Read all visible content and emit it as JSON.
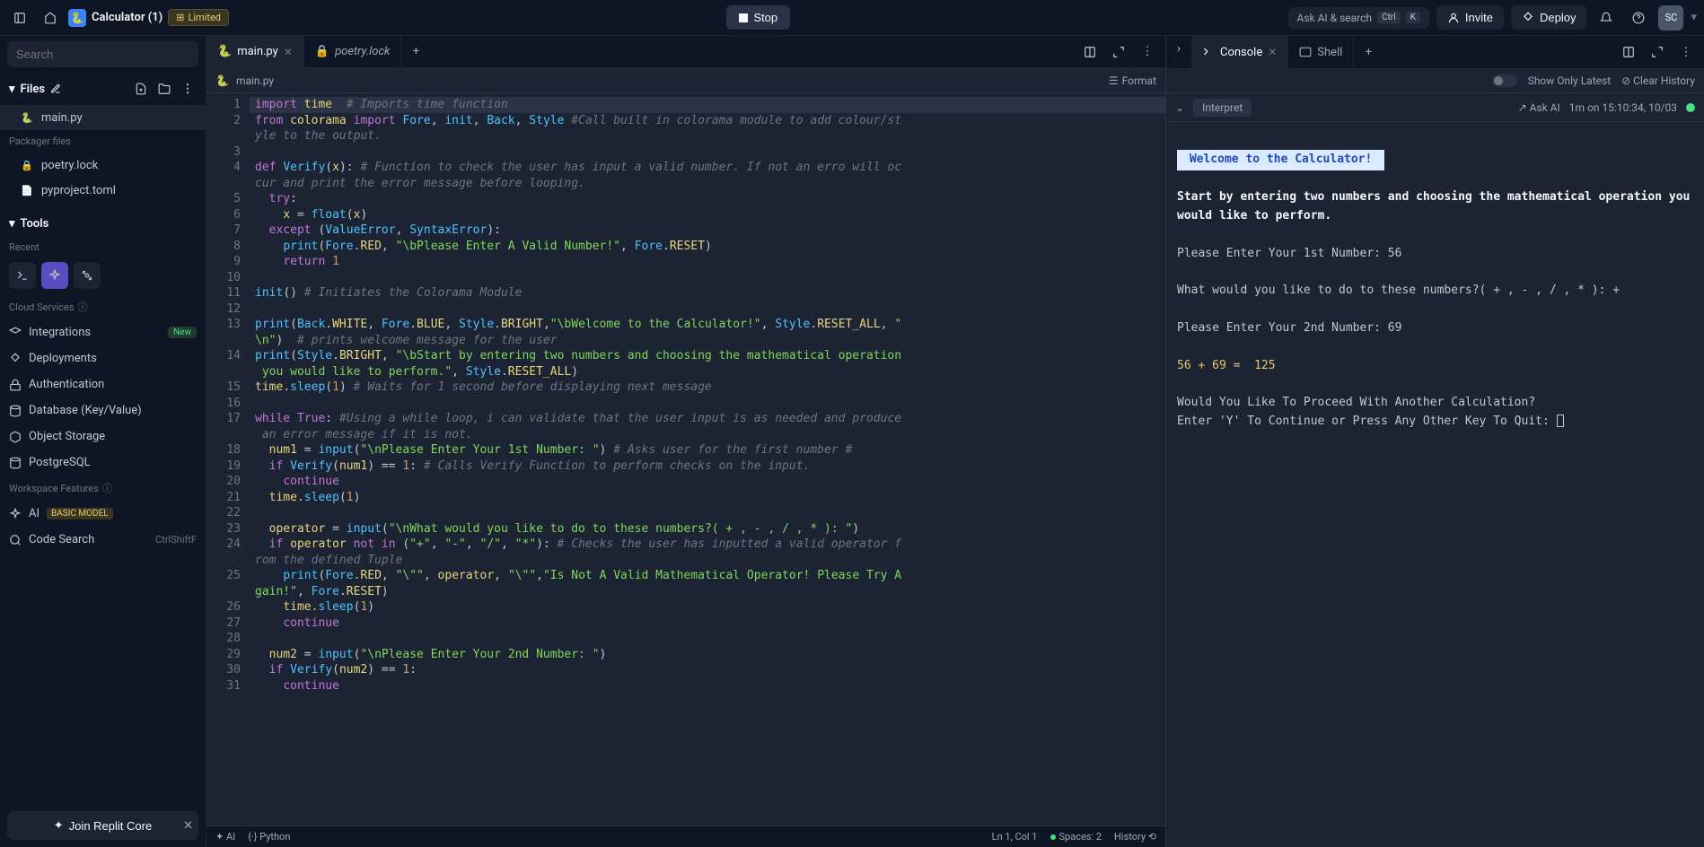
{
  "topbar": {
    "app_name": "Calculator (1)",
    "limited": "Limited",
    "stop": "Stop",
    "ask_ai": "Ask AI & search",
    "kbd_ctrl": "Ctrl",
    "kbd_k": "K",
    "invite": "Invite",
    "deploy": "Deploy",
    "avatar": "SC"
  },
  "sidebar": {
    "search_placeholder": "Search",
    "files_label": "Files",
    "files": [
      {
        "name": "main.py",
        "icon": "🐍"
      }
    ],
    "packager_label": "Packager files",
    "pkg": [
      {
        "name": "poetry.lock",
        "icon": "🔒"
      },
      {
        "name": "pyproject.toml",
        "icon": "📄"
      }
    ],
    "tools_label": "Tools",
    "recent_label": "Recent",
    "cloud_label": "Cloud Services",
    "cloud": [
      {
        "name": "Integrations",
        "badge": "New"
      },
      {
        "name": "Deployments"
      },
      {
        "name": "Authentication"
      },
      {
        "name": "Database (Key/Value)"
      },
      {
        "name": "Object Storage"
      },
      {
        "name": "PostgreSQL"
      }
    ],
    "workspace_label": "Workspace Features",
    "ws": [
      {
        "name": "AI",
        "badge": "BASIC MODEL"
      },
      {
        "name": "Code Search",
        "shortcut": "CtrlShiftF"
      }
    ],
    "join": "Join Replit Core"
  },
  "editor": {
    "tabs": [
      {
        "name": "main.py",
        "active": true
      },
      {
        "name": "poetry.lock",
        "active": false
      }
    ],
    "breadcrumb": "main.py",
    "format": "Format",
    "status": {
      "ai": "AI",
      "lang": "Python",
      "pos": "Ln 1, Col 1",
      "spaces": "Spaces: 2",
      "history": "History"
    }
  },
  "code": [
    [
      [
        "kw",
        "import"
      ],
      [
        "op",
        " "
      ],
      [
        "id",
        "time"
      ],
      [
        "op",
        "  "
      ],
      [
        "cmt",
        "# Imports time function"
      ]
    ],
    [
      [
        "kw",
        "from"
      ],
      [
        "op",
        " "
      ],
      [
        "id",
        "colorama"
      ],
      [
        "op",
        " "
      ],
      [
        "kw",
        "import"
      ],
      [
        "op",
        " "
      ],
      [
        "cls",
        "Fore"
      ],
      [
        "op",
        ", "
      ],
      [
        "cls",
        "init"
      ],
      [
        "op",
        ", "
      ],
      [
        "cls",
        "Back"
      ],
      [
        "op",
        ", "
      ],
      [
        "cls",
        "Style"
      ],
      [
        "op",
        " "
      ],
      [
        "cmt",
        "#Call built in colorama module to add colour/style to the output."
      ]
    ],
    [],
    [
      [
        "kw",
        "def"
      ],
      [
        "op",
        " "
      ],
      [
        "fn",
        "Verify"
      ],
      [
        "op",
        "("
      ],
      [
        "id",
        "x"
      ],
      [
        "op",
        "): "
      ],
      [
        "cmt",
        "# Function to check the user has input a valid number. If not an erro will occur and print the error message before looping."
      ]
    ],
    [
      [
        "op",
        "  "
      ],
      [
        "kw",
        "try"
      ],
      [
        "op",
        ":"
      ]
    ],
    [
      [
        "op",
        "    "
      ],
      [
        "id",
        "x"
      ],
      [
        "op",
        " = "
      ],
      [
        "fn",
        "float"
      ],
      [
        "op",
        "("
      ],
      [
        "id",
        "x"
      ],
      [
        "op",
        ")"
      ]
    ],
    [
      [
        "op",
        "  "
      ],
      [
        "kw",
        "except"
      ],
      [
        "op",
        " ("
      ],
      [
        "cls",
        "ValueError"
      ],
      [
        "op",
        ", "
      ],
      [
        "cls",
        "SyntaxError"
      ],
      [
        "op",
        "):"
      ]
    ],
    [
      [
        "op",
        "    "
      ],
      [
        "fn",
        "print"
      ],
      [
        "op",
        "("
      ],
      [
        "cls",
        "Fore"
      ],
      [
        "op",
        "."
      ],
      [
        "id",
        "RED"
      ],
      [
        "op",
        ", "
      ],
      [
        "str",
        "\"\\bPlease Enter A Valid Number!\""
      ],
      [
        "op",
        ", "
      ],
      [
        "cls",
        "Fore"
      ],
      [
        "op",
        "."
      ],
      [
        "id",
        "RESET"
      ],
      [
        "op",
        ")"
      ]
    ],
    [
      [
        "op",
        "    "
      ],
      [
        "kw",
        "return"
      ],
      [
        "op",
        " "
      ],
      [
        "num",
        "1"
      ]
    ],
    [],
    [
      [
        "fn",
        "init"
      ],
      [
        "op",
        "() "
      ],
      [
        "cmt",
        "# Initiates the Colorama Module"
      ]
    ],
    [],
    [
      [
        "fn",
        "print"
      ],
      [
        "op",
        "("
      ],
      [
        "cls",
        "Back"
      ],
      [
        "op",
        "."
      ],
      [
        "id",
        "WHITE"
      ],
      [
        "op",
        ", "
      ],
      [
        "cls",
        "Fore"
      ],
      [
        "op",
        "."
      ],
      [
        "id",
        "BLUE"
      ],
      [
        "op",
        ", "
      ],
      [
        "cls",
        "Style"
      ],
      [
        "op",
        "."
      ],
      [
        "id",
        "BRIGHT"
      ],
      [
        "op",
        ","
      ],
      [
        "str",
        "\"\\bWelcome to the Calculator!\""
      ],
      [
        "op",
        ", "
      ],
      [
        "cls",
        "Style"
      ],
      [
        "op",
        "."
      ],
      [
        "id",
        "RESET_ALL"
      ],
      [
        "op",
        ", "
      ],
      [
        "str",
        "\"\\n\""
      ],
      [
        "op",
        ")  "
      ],
      [
        "cmt",
        "# prints welcome message for the user"
      ]
    ],
    [
      [
        "fn",
        "print"
      ],
      [
        "op",
        "("
      ],
      [
        "cls",
        "Style"
      ],
      [
        "op",
        "."
      ],
      [
        "id",
        "BRIGHT"
      ],
      [
        "op",
        ", "
      ],
      [
        "str",
        "\"\\bStart by entering two numbers and choosing the mathematical operation you would like to perform.\""
      ],
      [
        "op",
        ", "
      ],
      [
        "cls",
        "Style"
      ],
      [
        "op",
        "."
      ],
      [
        "id",
        "RESET_ALL"
      ],
      [
        "op",
        ")"
      ]
    ],
    [
      [
        "id",
        "time"
      ],
      [
        "op",
        "."
      ],
      [
        "fn",
        "sleep"
      ],
      [
        "op",
        "("
      ],
      [
        "num",
        "1"
      ],
      [
        "op",
        ") "
      ],
      [
        "cmt",
        "# Waits for 1 second before displaying next message"
      ]
    ],
    [],
    [
      [
        "kw",
        "while"
      ],
      [
        "op",
        " "
      ],
      [
        "kw",
        "True"
      ],
      [
        "op",
        ": "
      ],
      [
        "cmt",
        "#Using a while loop, i can validate that the user input is as needed and produce an error message if it is not."
      ]
    ],
    [
      [
        "op",
        "  "
      ],
      [
        "id",
        "num1"
      ],
      [
        "op",
        " = "
      ],
      [
        "fn",
        "input"
      ],
      [
        "op",
        "("
      ],
      [
        "str",
        "\"\\nPlease Enter Your 1st Number: \""
      ],
      [
        "op",
        ") "
      ],
      [
        "cmt",
        "# Asks user for the first number #"
      ]
    ],
    [
      [
        "op",
        "  "
      ],
      [
        "kw",
        "if"
      ],
      [
        "op",
        " "
      ],
      [
        "fn",
        "Verify"
      ],
      [
        "op",
        "("
      ],
      [
        "id",
        "num1"
      ],
      [
        "op",
        ") == "
      ],
      [
        "num",
        "1"
      ],
      [
        "op",
        ": "
      ],
      [
        "cmt",
        "# Calls Verify Function to perform checks on the input."
      ]
    ],
    [
      [
        "op",
        "    "
      ],
      [
        "kw",
        "continue"
      ]
    ],
    [
      [
        "op",
        "  "
      ],
      [
        "id",
        "time"
      ],
      [
        "op",
        "."
      ],
      [
        "fn",
        "sleep"
      ],
      [
        "op",
        "("
      ],
      [
        "num",
        "1"
      ],
      [
        "op",
        ")"
      ]
    ],
    [],
    [
      [
        "op",
        "  "
      ],
      [
        "id",
        "operator"
      ],
      [
        "op",
        " = "
      ],
      [
        "fn",
        "input"
      ],
      [
        "op",
        "("
      ],
      [
        "str",
        "\"\\nWhat would you like to do to these numbers?( + , - , / , * ): \""
      ],
      [
        "op",
        ")"
      ]
    ],
    [
      [
        "op",
        "  "
      ],
      [
        "kw",
        "if"
      ],
      [
        "op",
        " "
      ],
      [
        "id",
        "operator"
      ],
      [
        "op",
        " "
      ],
      [
        "kw",
        "not"
      ],
      [
        "op",
        " "
      ],
      [
        "kw",
        "in"
      ],
      [
        "op",
        " ("
      ],
      [
        "str",
        "\"+\""
      ],
      [
        "op",
        ", "
      ],
      [
        "str",
        "\"-\""
      ],
      [
        "op",
        ", "
      ],
      [
        "str",
        "\"/\""
      ],
      [
        "op",
        ", "
      ],
      [
        "str",
        "\"*\""
      ],
      [
        "op",
        "): "
      ],
      [
        "cmt",
        "# Checks the user has inputted a valid operator from the defined Tuple"
      ]
    ],
    [
      [
        "op",
        "    "
      ],
      [
        "fn",
        "print"
      ],
      [
        "op",
        "("
      ],
      [
        "cls",
        "Fore"
      ],
      [
        "op",
        "."
      ],
      [
        "id",
        "RED"
      ],
      [
        "op",
        ", "
      ],
      [
        "str",
        "\"\\\"\""
      ],
      [
        "op",
        ", "
      ],
      [
        "id",
        "operator"
      ],
      [
        "op",
        ", "
      ],
      [
        "str",
        "\"\\\"\""
      ],
      [
        "op",
        ","
      ],
      [
        "str",
        "\"Is Not A Valid Mathematical Operator! Please Try Again!\""
      ],
      [
        "op",
        ", "
      ],
      [
        "cls",
        "Fore"
      ],
      [
        "op",
        "."
      ],
      [
        "id",
        "RESET"
      ],
      [
        "op",
        ")"
      ]
    ],
    [
      [
        "op",
        "    "
      ],
      [
        "id",
        "time"
      ],
      [
        "op",
        "."
      ],
      [
        "fn",
        "sleep"
      ],
      [
        "op",
        "("
      ],
      [
        "num",
        "1"
      ],
      [
        "op",
        ")"
      ]
    ],
    [
      [
        "op",
        "    "
      ],
      [
        "kw",
        "continue"
      ]
    ],
    [],
    [
      [
        "op",
        "  "
      ],
      [
        "id",
        "num2"
      ],
      [
        "op",
        " = "
      ],
      [
        "fn",
        "input"
      ],
      [
        "op",
        "("
      ],
      [
        "str",
        "\"\\nPlease Enter Your 2nd Number: \""
      ],
      [
        "op",
        ")"
      ]
    ],
    [
      [
        "op",
        "  "
      ],
      [
        "kw",
        "if"
      ],
      [
        "op",
        " "
      ],
      [
        "fn",
        "Verify"
      ],
      [
        "op",
        "("
      ],
      [
        "id",
        "num2"
      ],
      [
        "op",
        ") == "
      ],
      [
        "num",
        "1"
      ],
      [
        "op",
        ":"
      ]
    ],
    [
      [
        "op",
        "    "
      ],
      [
        "kw",
        "continue"
      ]
    ]
  ],
  "console": {
    "tabs": [
      {
        "name": "Console",
        "active": true
      },
      {
        "name": "Shell",
        "active": false
      }
    ],
    "show_latest": "Show Only Latest",
    "clear": "Clear History",
    "interpret": "Interpret",
    "ask_ai": "Ask AI",
    "timestamp": "1m on 15:10:34, 10/03",
    "output": {
      "welcome": " Welcome to the Calculator! ",
      "intro": "Start by entering two numbers and choosing the mathematical operation you would like to perform.",
      "p1": "Please Enter Your 1st Number: 56",
      "p2": "What would you like to do to these numbers?( + , - , / , * ): +",
      "p3": "Please Enter Your 2nd Number: 69",
      "result": "56 + 69 =  125",
      "p4": "Would You Like To Proceed With Another Calculation?",
      "p5": "Enter 'Y' To Continue or Press Any Other Key To Quit: "
    }
  }
}
